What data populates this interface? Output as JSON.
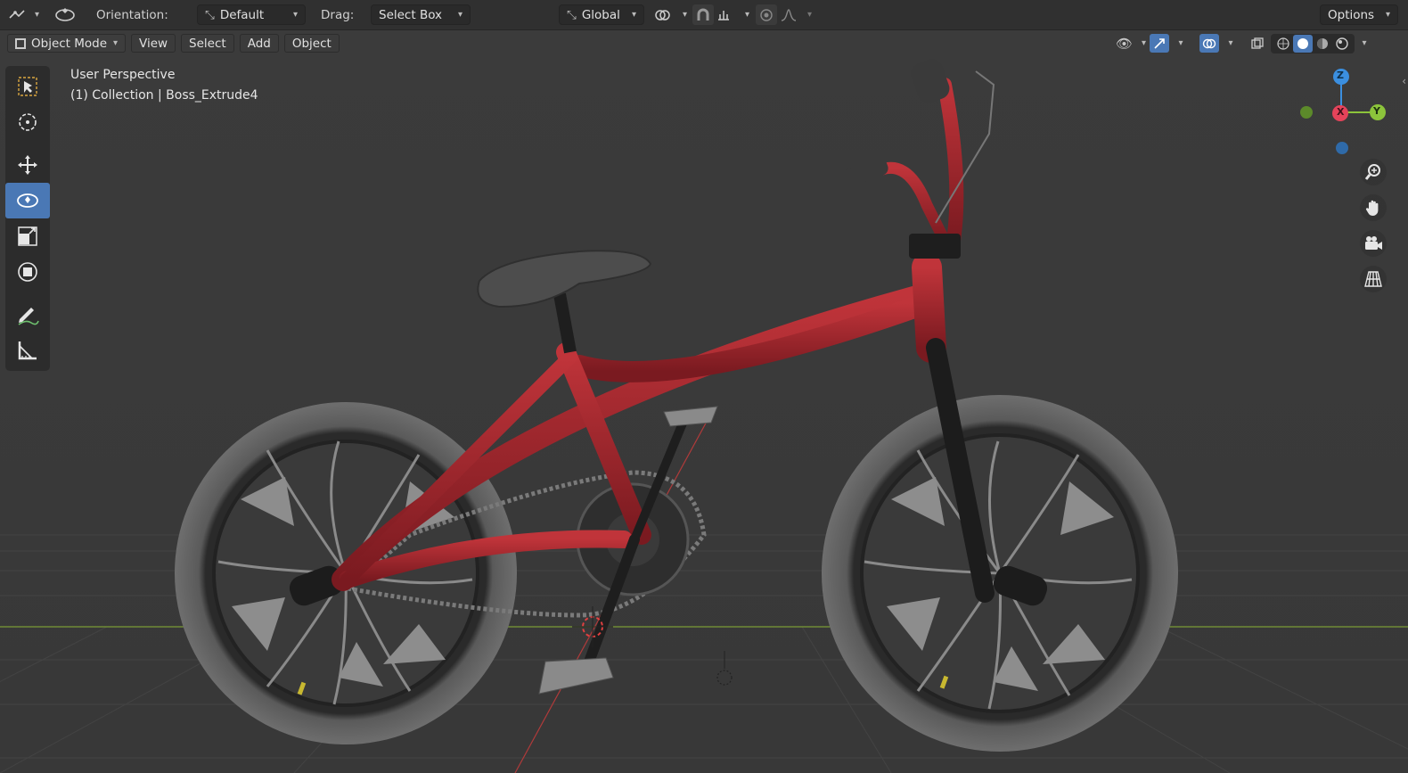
{
  "topbar": {
    "orientation_label": "Orientation:",
    "orientation_value": "Default",
    "drag_label": "Drag:",
    "drag_value": "Select Box",
    "transform_orientation": "Global",
    "options_label": "Options"
  },
  "header": {
    "mode": "Object Mode",
    "menus": [
      "View",
      "Select",
      "Add",
      "Object"
    ]
  },
  "viewport": {
    "view_name": "User Perspective",
    "collection_info": "(1) Collection | Boss_Extrude4"
  },
  "gizmo": {
    "axis_z": "Z",
    "axis_x": "X",
    "axis_y": "Y"
  },
  "colors": {
    "frame_red": "#a0232a",
    "active_tool": "#4a78b5",
    "axis_x": "#e5435a",
    "axis_y": "#8cc43b",
    "axis_z": "#3b8fe0"
  },
  "icons": {
    "select": "select-box-icon",
    "cursor": "cursor-icon",
    "move": "move-icon",
    "rotate": "rotate-icon",
    "scale": "scale-icon",
    "transform": "transform-icon",
    "annotate": "annotate-icon",
    "measure": "measure-icon"
  }
}
